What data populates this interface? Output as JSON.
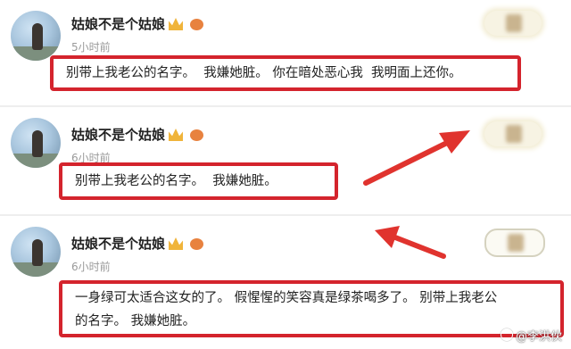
{
  "posts": [
    {
      "username": "姑娘不是个姑娘",
      "time": "5小时前",
      "comment": "别带上我老公的名字。  我嫌她脏。 你在暗处恶心我  我明面上还你。"
    },
    {
      "username": "姑娘不是个姑娘",
      "time": "6小时前",
      "comment": "别带上我老公的名字。  我嫌她脏。"
    },
    {
      "username": "姑娘不是个姑娘",
      "time": "6小时前",
      "comment_line1": "一身绿可太适合这女的了。 假惺惺的笑容真是绿茶喝多了。 别带上我老公",
      "comment_line2": "的名字。 我嫌她脏。"
    }
  ],
  "icons": {
    "vip_badge": "crown-icon",
    "member_badge": "pig-icon",
    "like": "like-icon"
  },
  "colors": {
    "highlight_box": "#d4242d",
    "arrow": "#e0332e",
    "time": "#9a9a9a"
  },
  "watermark": "@李洪伙"
}
